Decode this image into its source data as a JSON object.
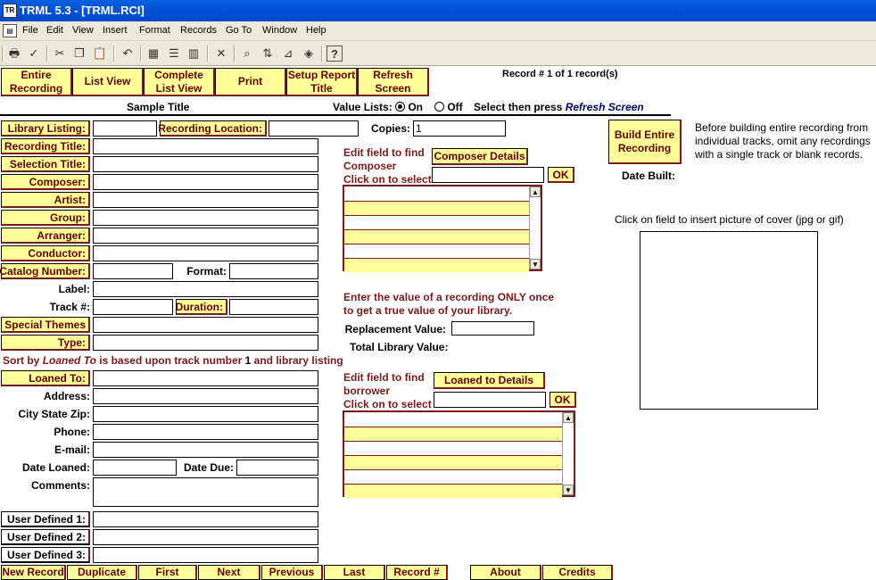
{
  "window": {
    "title": "TRML 5.3 - [TRML.RCI]",
    "app_icon": "trml-app-icon"
  },
  "menu": [
    "File",
    "Edit",
    "View",
    "Insert",
    "Format",
    "Records",
    "Go To",
    "Window",
    "Help"
  ],
  "top_buttons": {
    "entire_recording": "Entire Recording",
    "list_view": "List View",
    "complete_list_view": "Complete List View",
    "print": "Print",
    "setup_report_title": "Setup Report Title",
    "refresh_screen": "Refresh Screen"
  },
  "record_status": "Record # 1 of 1 record(s)",
  "report_title": "Sample Title",
  "value_lists": {
    "label": "Value Lists:",
    "on": "On",
    "off": "Off",
    "selected": "On",
    "hint_prefix": "Select then press",
    "hint_action": "Refresh Screen"
  },
  "fields": {
    "library_listing": {
      "label": "Library Listing:",
      "value": ""
    },
    "recording_location": {
      "label": "Recording Location:",
      "value": ""
    },
    "copies": {
      "label": "Copies:",
      "value": "1"
    },
    "recording_title": {
      "label": "Recording Title:",
      "value": ""
    },
    "selection_title": {
      "label": "Selection Title:",
      "value": ""
    },
    "composer": {
      "label": "Composer:",
      "value": ""
    },
    "artist": {
      "label": "Artist:",
      "value": ""
    },
    "group": {
      "label": "Group:",
      "value": ""
    },
    "arranger": {
      "label": "Arranger:",
      "value": ""
    },
    "conductor": {
      "label": "Conductor:",
      "value": ""
    },
    "catalog_number": {
      "label": "Catalog Number:",
      "value": ""
    },
    "format": {
      "label": "Format:",
      "value": ""
    },
    "label_field": {
      "label": "Label:",
      "value": ""
    },
    "track": {
      "label": "Track #:",
      "value": ""
    },
    "duration": {
      "label": "Duration:",
      "value": ""
    },
    "special_themes": {
      "label": "Special Themes",
      "value": ""
    },
    "type": {
      "label": "Type:",
      "value": ""
    },
    "loaned_to": {
      "label": "Loaned To:",
      "value": ""
    },
    "address": {
      "label": "Address:",
      "value": ""
    },
    "city_state_zip": {
      "label": "City State Zip:",
      "value": ""
    },
    "phone": {
      "label": "Phone:",
      "value": ""
    },
    "email": {
      "label": "E-mail:",
      "value": ""
    },
    "date_loaned": {
      "label": "Date Loaned:",
      "value": ""
    },
    "date_due": {
      "label": "Date Due:",
      "value": ""
    },
    "comments": {
      "label": "Comments:",
      "value": ""
    },
    "user_defined_1": {
      "label": "User Defined 1:",
      "value": ""
    },
    "user_defined_2": {
      "label": "User Defined 2:",
      "value": ""
    },
    "user_defined_3": {
      "label": "User Defined 3:",
      "value": ""
    },
    "replacement_value": {
      "label": "Replacement Value:",
      "value": ""
    }
  },
  "sort_note": {
    "prefix": "Sort by",
    "field": "Loaned To",
    "middle": "is based upon track number",
    "num": "1",
    "suffix": "and library listing"
  },
  "composer_lookup": {
    "line1": "Edit field to find",
    "line2": "Composer",
    "line3": "Click on to select",
    "details_button": "Composer Details",
    "ok": "OK"
  },
  "loaned_lookup": {
    "line1": "Edit field to find",
    "line2": "borrower",
    "line3": "Click on to select",
    "details_button": "Loaned to Details",
    "ok": "OK"
  },
  "value_note": {
    "line1": "Enter the value of a recording ONLY once",
    "line2": "to get a true value of your library."
  },
  "total_library_value": "Total Library Value:",
  "build": {
    "button": "Build Entire Recording",
    "note": "Before building entire recording from individual tracks, omit any recordings with a single track or blank records.",
    "date_built": "Date Built:"
  },
  "cover_note": "Click on field to insert picture of cover (jpg or gif)",
  "bottom_buttons": {
    "new_record": "New Record",
    "duplicate": "Duplicate",
    "first": "First",
    "next": "Next",
    "previous": "Previous",
    "last": "Last",
    "record_num": "Record #",
    "about": "About",
    "credits": "Credits"
  }
}
